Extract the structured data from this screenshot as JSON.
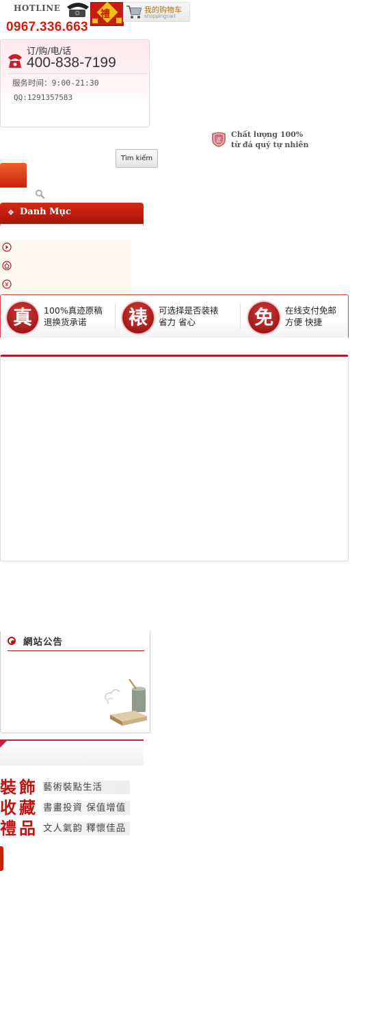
{
  "header": {
    "hotline_label": "HOTLINE",
    "hotline_number": "0967.336.663",
    "gift_icon_text": "禮",
    "cart": {
      "title": "我的购物车",
      "subtitle": "shoppingcart"
    }
  },
  "order_box": {
    "title": "订/购/电/话",
    "phone": "400-838-7199",
    "hours": "服务时间：9:00-21:30",
    "qq": "QQ:1291357583"
  },
  "quality": {
    "line1": "Chất lượng 100%",
    "line2": "từ đá quý tự nhiên"
  },
  "search": {
    "button_label": "Tìm kiếm"
  },
  "categories": {
    "title": "Danh Mục",
    "items": [
      {
        "icon": "arrow-circle-icon"
      },
      {
        "icon": "home-icon"
      },
      {
        "icon": "yen-icon"
      }
    ]
  },
  "trust_bar": {
    "items": [
      {
        "badge": "真",
        "line1": "100%真迹原稿",
        "line2": "退换货承诺"
      },
      {
        "badge": "裱",
        "line1": "可选择是否装裱",
        "line2": "省力 省心"
      },
      {
        "badge": "免",
        "line1": "在线支付免邮",
        "line2": "方便 快捷"
      }
    ]
  },
  "notice": {
    "title": "網站公告"
  },
  "features": [
    {
      "big": "裝飾",
      "small": "藝術裝點生活"
    },
    {
      "big": "收藏",
      "small": "書畫投資 保值增值"
    },
    {
      "big": "禮品",
      "small": "文人氣韵 釋懷佳品"
    }
  ],
  "colors": {
    "brand_red": "#c8200e",
    "hotline_red": "#d11d12",
    "header_red": "#b11d1d"
  }
}
